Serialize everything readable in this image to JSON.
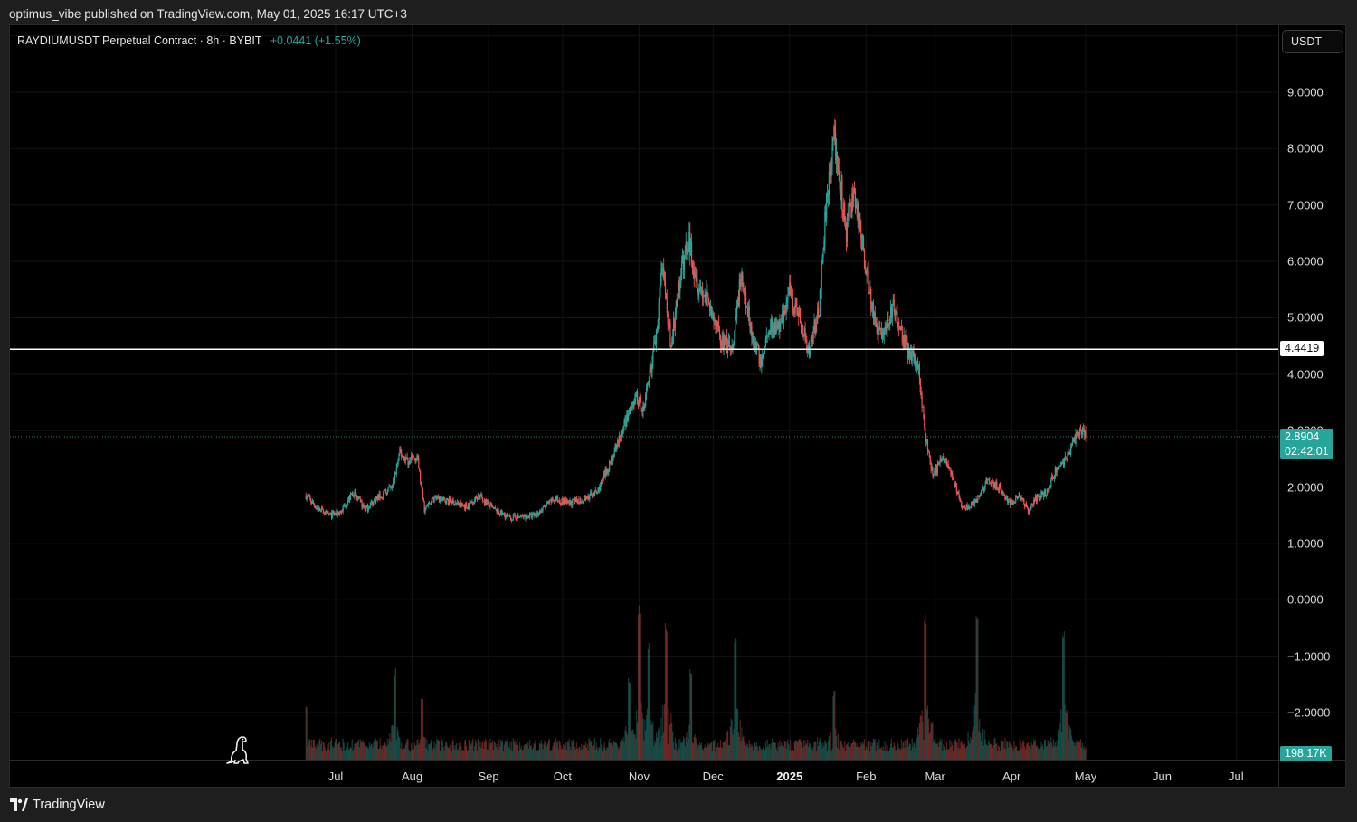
{
  "caption": "optimus_vibe published on TradingView.com, May 01, 2025 16:17 UTC+3",
  "legend": {
    "symbol": "RAYDIUMUSDT Perpetual Contract · 8h · BYBIT",
    "change": "+0.0441 (+1.55%)"
  },
  "currency": "USDT",
  "price_axis": [
    "9.0000",
    "8.0000",
    "7.0000",
    "6.0000",
    "5.0000",
    "4.0000",
    "3.0000",
    "2.0000",
    "1.0000",
    "0.0000",
    "−1.0000",
    "−2.0000"
  ],
  "horizontal_line": {
    "value": 4.4419,
    "label": "4.4419",
    "color": "#ffffff"
  },
  "last_price": {
    "value": 2.8904,
    "label": "2.8904",
    "countdown": "02:42:01",
    "color": "#26a69a"
  },
  "volume_label": "198.17K",
  "time_axis": [
    {
      "label": "Jul",
      "bold": false
    },
    {
      "label": "Aug",
      "bold": false
    },
    {
      "label": "Sep",
      "bold": false
    },
    {
      "label": "Oct",
      "bold": false
    },
    {
      "label": "Nov",
      "bold": false
    },
    {
      "label": "Dec",
      "bold": false
    },
    {
      "label": "2025",
      "bold": true
    },
    {
      "label": "Feb",
      "bold": false
    },
    {
      "label": "Mar",
      "bold": false
    },
    {
      "label": "Apr",
      "bold": false
    },
    {
      "label": "May",
      "bold": false
    },
    {
      "label": "Jun",
      "bold": false
    },
    {
      "label": "Jul",
      "bold": false
    }
  ],
  "colors": {
    "up": "#26a69a",
    "down": "#ef5350",
    "background": "#000000",
    "grid": "#141414"
  },
  "footer": {
    "brand": "TradingView",
    "logo_icon": "tradingview-logo-icon"
  },
  "chart_data": {
    "type": "candlestick",
    "title": "RAYDIUMUSDT Perpetual Contract · 8h · BYBIT",
    "interval": "8h",
    "currency": "USDT",
    "ylim": [
      -2.4,
      9.6
    ],
    "xlim": [
      "2024-06-01",
      "2025-07-20"
    ],
    "grid": true,
    "price_path": [
      {
        "date": "2024-06-19",
        "close": 1.85
      },
      {
        "date": "2024-06-24",
        "close": 1.6
      },
      {
        "date": "2024-06-29",
        "close": 1.5
      },
      {
        "date": "2024-07-03",
        "close": 1.55
      },
      {
        "date": "2024-07-08",
        "close": 1.9
      },
      {
        "date": "2024-07-13",
        "close": 1.6
      },
      {
        "date": "2024-07-18",
        "close": 1.8
      },
      {
        "date": "2024-07-24",
        "close": 2.0
      },
      {
        "date": "2024-07-27",
        "close": 2.6
      },
      {
        "date": "2024-07-31",
        "close": 2.45
      },
      {
        "date": "2024-08-03",
        "close": 2.55
      },
      {
        "date": "2024-08-06",
        "close": 1.6
      },
      {
        "date": "2024-08-10",
        "close": 1.8
      },
      {
        "date": "2024-08-16",
        "close": 1.75
      },
      {
        "date": "2024-08-23",
        "close": 1.65
      },
      {
        "date": "2024-08-28",
        "close": 1.85
      },
      {
        "date": "2024-09-03",
        "close": 1.6
      },
      {
        "date": "2024-09-10",
        "close": 1.45
      },
      {
        "date": "2024-09-20",
        "close": 1.5
      },
      {
        "date": "2024-09-28",
        "close": 1.8
      },
      {
        "date": "2024-10-03",
        "close": 1.7
      },
      {
        "date": "2024-10-10",
        "close": 1.8
      },
      {
        "date": "2024-10-15",
        "close": 1.9
      },
      {
        "date": "2024-10-20",
        "close": 2.4
      },
      {
        "date": "2024-10-25",
        "close": 3.0
      },
      {
        "date": "2024-10-31",
        "close": 3.6
      },
      {
        "date": "2024-11-03",
        "close": 3.4
      },
      {
        "date": "2024-11-08",
        "close": 4.7
      },
      {
        "date": "2024-11-10",
        "close": 6.0
      },
      {
        "date": "2024-11-14",
        "close": 4.5
      },
      {
        "date": "2024-11-18",
        "close": 5.8
      },
      {
        "date": "2024-11-21",
        "close": 6.4
      },
      {
        "date": "2024-11-25",
        "close": 5.6
      },
      {
        "date": "2024-11-30",
        "close": 5.2
      },
      {
        "date": "2024-12-04",
        "close": 4.6
      },
      {
        "date": "2024-12-09",
        "close": 4.4
      },
      {
        "date": "2024-12-12",
        "close": 5.7
      },
      {
        "date": "2024-12-17",
        "close": 4.7
      },
      {
        "date": "2024-12-20",
        "close": 4.2
      },
      {
        "date": "2024-12-24",
        "close": 4.9
      },
      {
        "date": "2024-12-28",
        "close": 4.8
      },
      {
        "date": "2025-01-01",
        "close": 5.5
      },
      {
        "date": "2025-01-05",
        "close": 5.0
      },
      {
        "date": "2025-01-09",
        "close": 4.4
      },
      {
        "date": "2025-01-13",
        "close": 5.2
      },
      {
        "date": "2025-01-16",
        "close": 7.2
      },
      {
        "date": "2025-01-19",
        "close": 8.2
      },
      {
        "date": "2025-01-22",
        "close": 7.2
      },
      {
        "date": "2025-01-24",
        "close": 6.5
      },
      {
        "date": "2025-01-27",
        "close": 7.2
      },
      {
        "date": "2025-01-31",
        "close": 6.2
      },
      {
        "date": "2025-02-04",
        "close": 5.0
      },
      {
        "date": "2025-02-08",
        "close": 4.7
      },
      {
        "date": "2025-02-12",
        "close": 5.2
      },
      {
        "date": "2025-02-15",
        "close": 4.8
      },
      {
        "date": "2025-02-19",
        "close": 4.3
      },
      {
        "date": "2025-02-22",
        "close": 4.2
      },
      {
        "date": "2025-02-25",
        "close": 2.9
      },
      {
        "date": "2025-02-28",
        "close": 2.2
      },
      {
        "date": "2025-03-04",
        "close": 2.5
      },
      {
        "date": "2025-03-08",
        "close": 2.2
      },
      {
        "date": "2025-03-12",
        "close": 1.6
      },
      {
        "date": "2025-03-17",
        "close": 1.7
      },
      {
        "date": "2025-03-22",
        "close": 2.1
      },
      {
        "date": "2025-03-27",
        "close": 2.0
      },
      {
        "date": "2025-03-31",
        "close": 1.7
      },
      {
        "date": "2025-04-04",
        "close": 1.85
      },
      {
        "date": "2025-04-08",
        "close": 1.55
      },
      {
        "date": "2025-04-11",
        "close": 1.8
      },
      {
        "date": "2025-04-15",
        "close": 1.9
      },
      {
        "date": "2025-04-19",
        "close": 2.3
      },
      {
        "date": "2025-04-23",
        "close": 2.5
      },
      {
        "date": "2025-04-26",
        "close": 2.8
      },
      {
        "date": "2025-04-29",
        "close": 3.05
      },
      {
        "date": "2025-05-01",
        "close": 2.89
      }
    ],
    "volume_spikes": [
      {
        "date": "2024-06-19",
        "rel": 0.35
      },
      {
        "date": "2024-07-25",
        "rel": 0.6
      },
      {
        "date": "2024-08-05",
        "rel": 0.4
      },
      {
        "date": "2024-10-28",
        "rel": 0.55
      },
      {
        "date": "2024-11-01",
        "rel": 1.0
      },
      {
        "date": "2024-11-05",
        "rel": 0.75
      },
      {
        "date": "2024-11-12",
        "rel": 0.9
      },
      {
        "date": "2024-11-22",
        "rel": 0.6
      },
      {
        "date": "2024-12-10",
        "rel": 0.8
      },
      {
        "date": "2025-01-19",
        "rel": 0.45
      },
      {
        "date": "2025-02-25",
        "rel": 0.95
      },
      {
        "date": "2025-03-18",
        "rel": 1.0
      },
      {
        "date": "2025-04-22",
        "rel": 0.85
      }
    ]
  }
}
